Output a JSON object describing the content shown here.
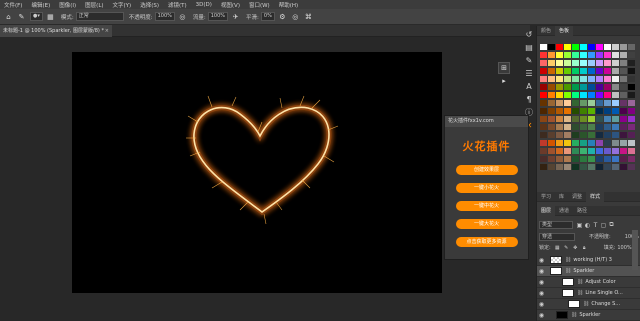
{
  "menubar": [
    "文件(F)",
    "编辑(E)",
    "图像(I)",
    "图层(L)",
    "文字(Y)",
    "选择(S)",
    "滤镜(T)",
    "3D(D)",
    "视图(V)",
    "窗口(W)",
    "帮助(H)"
  ],
  "options": {
    "mode_label": "模式:",
    "mode_value": "正常",
    "opacity_label": "不透明度:",
    "opacity_value": "100%",
    "flow_label": "流量:",
    "flow_value": "100%",
    "smooth_label": "平滑:",
    "smooth_value": "0%"
  },
  "document": {
    "tab_title": "未标题-1 @ 100% (Sparkler, 图层蒙版/8) *",
    "close": "×"
  },
  "plugin": {
    "header": "花火插件fxx1v.com",
    "title": "火花插件",
    "buttons": [
      "创建效果层",
      "一键小花火",
      "一键中花火",
      "一键大花火",
      "点击获取更多资源"
    ]
  },
  "panels": {
    "top_tabs": [
      "颜色",
      "色板"
    ],
    "lib_tabs": [
      "学习",
      "库",
      "调整",
      "样式"
    ],
    "layer_tabs": [
      "图层",
      "通道",
      "路径"
    ],
    "filter_label": "类型",
    "blend_label": "穿透",
    "opacity_label": "不透明度:",
    "opacity_value": "100%",
    "lock_label": "锁定:",
    "fill_label": "填充:",
    "fill_value": "100%"
  },
  "layers": [
    {
      "name": "working (H/T) 3",
      "thumb": "check",
      "indent": 0,
      "selected": false
    },
    {
      "name": "Sparkler",
      "thumb": "white",
      "indent": 0,
      "selected": true
    },
    {
      "name": "Adjust Color",
      "thumb": "white",
      "indent": 2,
      "selected": false
    },
    {
      "name": "Line Single O...",
      "thumb": "white",
      "indent": 2,
      "selected": false
    },
    {
      "name": "Change S...",
      "thumb": "white",
      "indent": 3,
      "selected": false
    },
    {
      "name": "Sparkler",
      "thumb": "black",
      "indent": 1,
      "selected": false
    }
  ],
  "colors": {
    "accent": "#ff8c00",
    "plugin_title": "#ff7a00",
    "heart_glow": "#ffb347"
  },
  "icons": {
    "brush": "brush-icon",
    "eye": "eye-icon",
    "lock": "lock-icon",
    "folder": "folder-icon"
  }
}
